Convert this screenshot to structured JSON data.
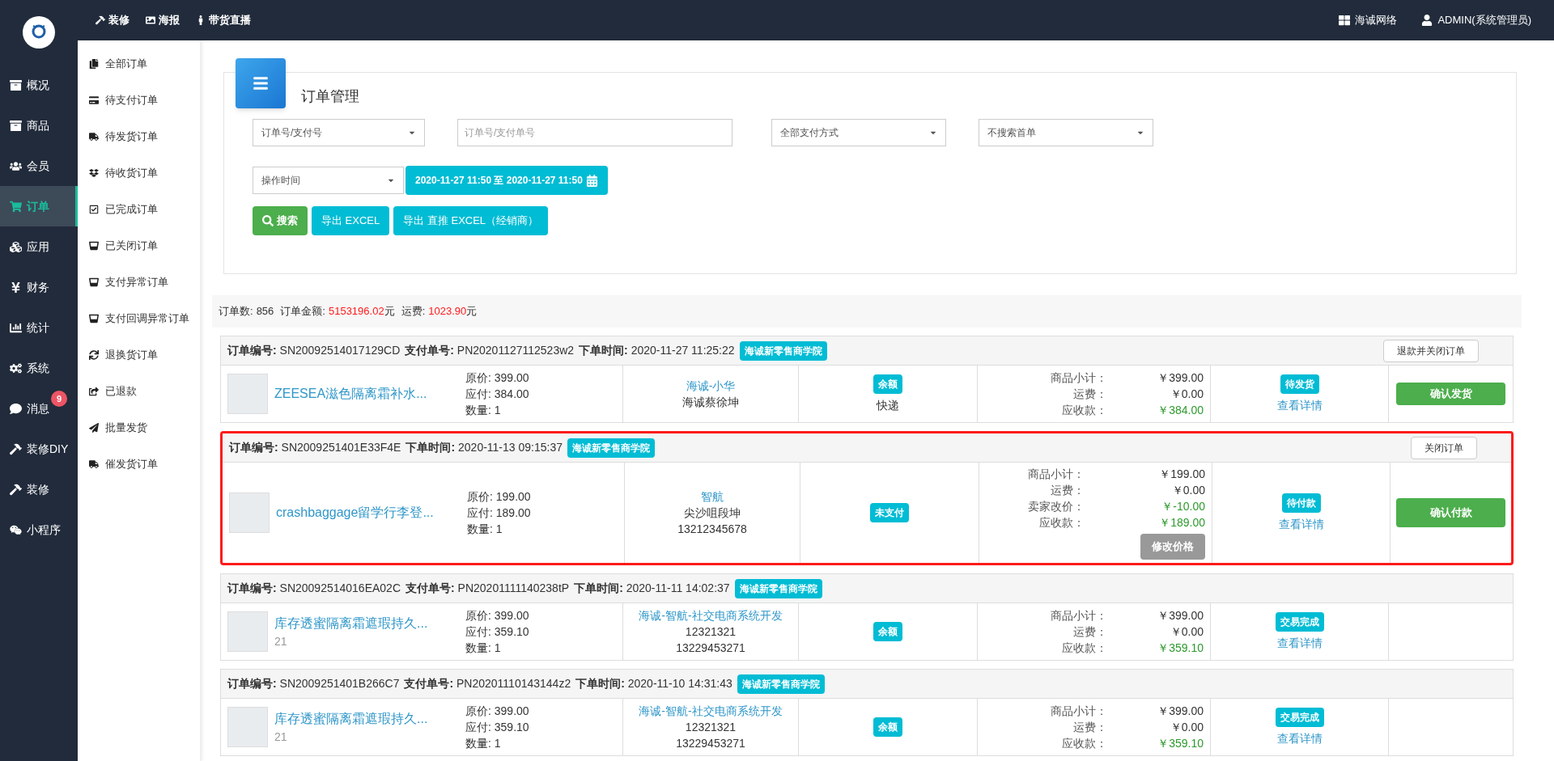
{
  "top_bar": {
    "links": [
      "装修",
      "海报",
      "带货直播"
    ],
    "right": [
      "海诚网络",
      "ADMIN(系统管理员)"
    ]
  },
  "nav": [
    {
      "label": "概况",
      "selected": false
    },
    {
      "label": "商品",
      "selected": false
    },
    {
      "label": "会员",
      "selected": false
    },
    {
      "label": "订单",
      "selected": true
    },
    {
      "label": "应用",
      "selected": false
    },
    {
      "label": "财务",
      "selected": false
    },
    {
      "label": "统计",
      "selected": false
    },
    {
      "label": "系统",
      "selected": false
    },
    {
      "label": "消息",
      "selected": false,
      "badge": "9"
    },
    {
      "label": "装修DIY",
      "selected": false
    },
    {
      "label": "装修",
      "selected": false
    },
    {
      "label": "小程序",
      "selected": false
    }
  ],
  "submenu": [
    "全部订单",
    "待支付订单",
    "待发货订单",
    "待收货订单",
    "已完成订单",
    "已关闭订单",
    "支付异常订单",
    "支付回调异常订单",
    "退换货订单",
    "已退款",
    "批量发货",
    "催发货订单"
  ],
  "panel": {
    "title": "订单管理",
    "search_type": "订单号/支付号",
    "search_placeholder": "订单号/支付单号",
    "pay_method": "全部支付方式",
    "first_order": "不搜索首单",
    "time_type": "操作时间",
    "date_range": "2020-11-27 11:50 至 2020-11-27 11:50",
    "buttons": [
      {
        "kind": "search",
        "label": "搜索"
      },
      {
        "kind": "export",
        "label": "导出 EXCEL"
      },
      {
        "kind": "export",
        "label": "导出 直推 EXCEL（经销商）"
      }
    ]
  },
  "summary": [
    {
      "label": "订单数:",
      "value": "856",
      "highlight": false
    },
    {
      "label": "订单金额:",
      "value": "5153196.02",
      "unit": "元",
      "highlight": true
    },
    {
      "label": "运费:",
      "value": "1023.90",
      "unit": "元",
      "highlight": true
    }
  ],
  "orders": [
    {
      "highlighted": false,
      "header": [
        {
          "label": "订单编号:",
          "value": "SN20092514017129CD"
        },
        {
          "label": "支付单号:",
          "value": "PN20201127112523w2"
        },
        {
          "label": "下单时间:",
          "value": "2020-11-27 11:25:22"
        }
      ],
      "tag": "海诚新零售商学院",
      "top_action": "退款并关闭订单",
      "product": "ZEESEA滋色隔离霜补水...",
      "prices": [
        "原价: 399.00",
        "应付: 384.00",
        "数量: 1"
      ],
      "buyer": [
        "海诚-小华",
        "海诚蔡徐坤"
      ],
      "pay_tag": "余额",
      "pay_method": "快递",
      "totals": [
        {
          "label": "商品小计：",
          "value": "￥399.00",
          "green": false
        },
        {
          "label": "运费：",
          "value": "￥0.00",
          "green": false
        },
        {
          "label": "应收款：",
          "value": "￥384.00",
          "green": true
        }
      ],
      "status": "待发货",
      "detail": "查看详情",
      "action": "确认发货"
    },
    {
      "highlighted": true,
      "header": [
        {
          "label": "订单编号:",
          "value": "SN2009251401E33F4E"
        },
        {
          "label": "下单时间:",
          "value": "2020-11-13 09:15:37"
        }
      ],
      "tag": "海诚新零售商学院",
      "top_action": "关闭订单",
      "product": "crashbaggage留学行李登...",
      "prices": [
        "原价: 199.00",
        "应付: 189.00",
        "数量: 1"
      ],
      "buyer": [
        "智航",
        "尖沙咀段坤",
        "13212345678"
      ],
      "pay_tag": "未支付",
      "totals": [
        {
          "label": "商品小计：",
          "value": "￥199.00",
          "green": false
        },
        {
          "label": "运费：",
          "value": "￥0.00",
          "green": false
        },
        {
          "label": "卖家改价：",
          "value": "￥-10.00",
          "green": true
        },
        {
          "label": "应收款：",
          "value": "￥189.00",
          "green": true
        }
      ],
      "edit_price": "修改价格",
      "status": "待付款",
      "detail": "查看详情",
      "action": "确认付款"
    },
    {
      "highlighted": false,
      "header": [
        {
          "label": "订单编号:",
          "value": "SN20092514016EA02C"
        },
        {
          "label": "支付单号:",
          "value": "PN20201111140238tP"
        },
        {
          "label": "下单时间:",
          "value": "2020-11-11 14:02:37"
        }
      ],
      "tag": "海诚新零售商学院",
      "product": "库存透蜜隔离霜遮瑕持久...",
      "product_sub": "21",
      "prices": [
        "原价: 399.00",
        "应付: 359.10",
        "数量: 1"
      ],
      "buyer": [
        "海诚-智航-社交电商系统开发",
        "12321321",
        "13229453271"
      ],
      "pay_tag": "余额",
      "totals": [
        {
          "label": "商品小计：",
          "value": "￥399.00",
          "green": false
        },
        {
          "label": "运费：",
          "value": "￥0.00",
          "green": false
        },
        {
          "label": "应收款：",
          "value": "￥359.10",
          "green": true
        }
      ],
      "status": "交易完成",
      "detail": "查看详情"
    },
    {
      "highlighted": false,
      "header": [
        {
          "label": "订单编号:",
          "value": "SN2009251401B266C7"
        },
        {
          "label": "支付单号:",
          "value": "PN20201110143144z2"
        },
        {
          "label": "下单时间:",
          "value": "2020-11-10 14:31:43"
        }
      ],
      "tag": "海诚新零售商学院",
      "product": "库存透蜜隔离霜遮瑕持久...",
      "product_sub": "21",
      "prices": [
        "原价: 399.00",
        "应付: 359.10",
        "数量: 1"
      ],
      "buyer": [
        "海诚-智航-社交电商系统开发",
        "12321321",
        "13229453271"
      ],
      "pay_tag": "余额",
      "totals": [
        {
          "label": "商品小计：",
          "value": "￥399.00",
          "green": false
        },
        {
          "label": "运费：",
          "value": "￥0.00",
          "green": false
        },
        {
          "label": "应收款：",
          "value": "￥359.10",
          "green": true
        }
      ],
      "status": "交易完成",
      "detail": "查看详情"
    }
  ]
}
